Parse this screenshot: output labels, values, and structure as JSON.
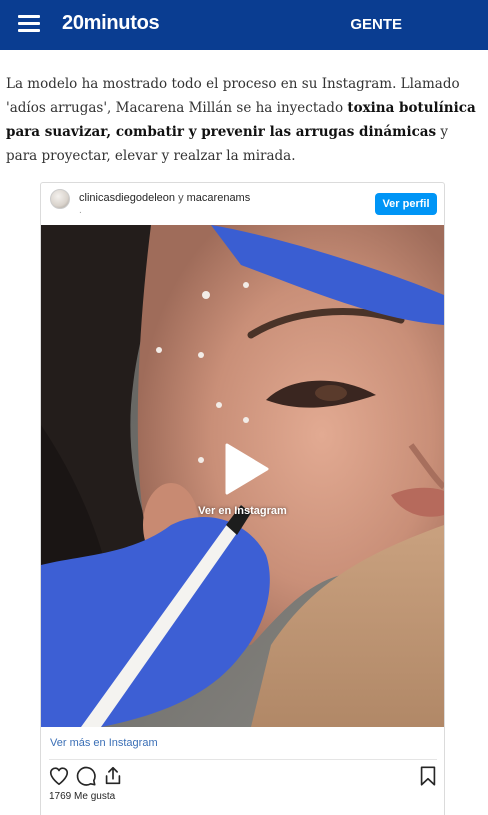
{
  "header": {
    "logo": "20minutos",
    "section": "GENTE"
  },
  "article": {
    "text_1": "La modelo ha mostrado todo el proceso en su Instagram. Llamado 'adíos arrugas', Macarena Millán se ha inyectado ",
    "bold_1": "toxina botulínica para suavizar, combatir y prevenir las arrugas dinámicas",
    "text_2": " y para proyectar, elevar y realzar la mirada."
  },
  "instagram": {
    "account_1": "clinicasdiegodeleon",
    "separator": "y",
    "account_2": "macarenams",
    "dot": ".",
    "follow_label": "Ver perfil",
    "play_label": "Ver en Instagram",
    "more_label": "Ver más en Instagram",
    "likes": "1769 Me gusta",
    "follow_color": "#0095f6",
    "icons": [
      "heart-icon",
      "comment-icon",
      "share-icon",
      "bookmark-icon"
    ]
  }
}
